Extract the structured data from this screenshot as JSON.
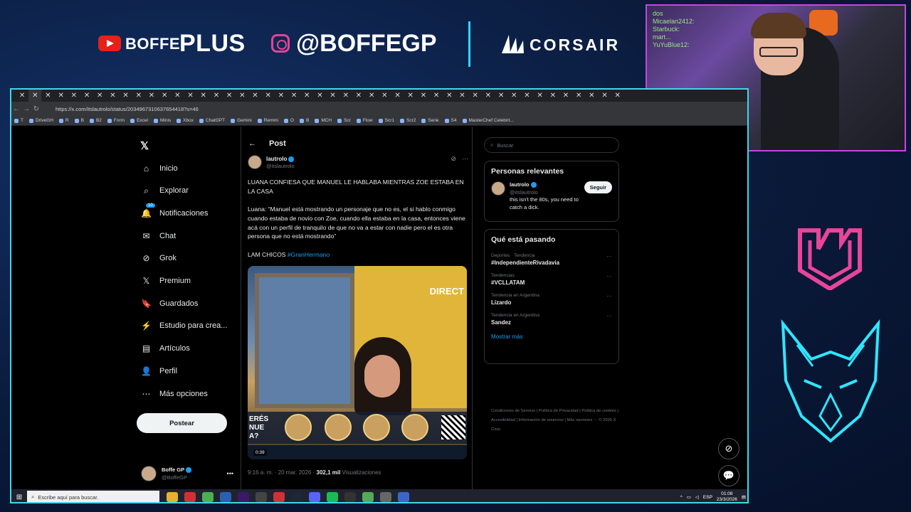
{
  "banner": {
    "youtube_name": "BOFFE",
    "youtube_plus": "PLUS",
    "instagram_handle": "@BOFFEGP",
    "sponsor": "CORSAIR"
  },
  "webcam": {
    "chat_lines": [
      "dos",
      "Micaelan2412:",
      "Starbuck:",
      "mart...",
      "YuYuBlue12:"
    ]
  },
  "browser": {
    "url": "https://x.com/itslautrolo/status/2034967310637654418?s=46",
    "bookmarks": [
      "T",
      "DriveGH",
      "R",
      "B",
      "B2",
      "Form",
      "Excel",
      "Minis",
      "Xbox",
      "ChatGPT",
      "Gemini",
      "Remini",
      "O",
      "B",
      "MCH",
      "Scr",
      "Flow",
      "Scr1",
      "Scr2",
      "Serie",
      "S4",
      "MasterChef Celebrit..."
    ]
  },
  "x": {
    "nav": [
      {
        "label": "Inicio",
        "icon": "home-icon"
      },
      {
        "label": "Explorar",
        "icon": "search-icon"
      },
      {
        "label": "Notificaciones",
        "icon": "bell-icon",
        "badge": "10"
      },
      {
        "label": "Chat",
        "icon": "chat-icon"
      },
      {
        "label": "Grok",
        "icon": "grok-icon"
      },
      {
        "label": "Premium",
        "icon": "premium-icon"
      },
      {
        "label": "Guardados",
        "icon": "bookmark-icon"
      },
      {
        "label": "Estudio para crea...",
        "icon": "studio-icon"
      },
      {
        "label": "Artículos",
        "icon": "articles-icon"
      },
      {
        "label": "Perfil",
        "icon": "profile-icon"
      },
      {
        "label": "Más opciones",
        "icon": "more-icon"
      }
    ],
    "post_button": "Postear",
    "profile": {
      "name": "Boffe GP",
      "handle": "@BoffeGP"
    },
    "post": {
      "header": "Post",
      "author_name": "lautrolo",
      "author_handle": "@itslautrolo",
      "text1": "LUANA CONFIESA QUE MANUEL LE HABLABA MIENTRAS ZOE ESTABA EN LA CASA",
      "text2": "Luana: “Manuel está mostrando un personaje que no es, el si hablo conmigo cuando estaba de novio con Zoe, cuando ella estaba en la casa, entonces viene acá con un perfil de tranquilo de que no va a estar con nadie pero el es otra persona que no está mostrando”",
      "text3_prefix": "LAM CHICOS ",
      "hashtag": "#GranHermano",
      "media_directo": "DIRECT",
      "media_vote": "ERÉS\nNUE\nA?",
      "media_time": "0:39",
      "timestamp": "9:16 a. m. · 20 mar. 2026 · ",
      "views_count": "302,1 mil",
      "views_label": " Visualizaciones"
    },
    "search_placeholder": "Buscar",
    "relevant": {
      "title": "Personas relevantes",
      "name": "lautrolo",
      "handle": "@itslautrolo",
      "bio": "this isn't the 80s, you need to catch a dick.",
      "follow": "Seguir"
    },
    "trends": {
      "title": "Qué está pasando",
      "items": [
        {
          "context": "Deportes · Tendencia",
          "topic": "#IndependienteRivadavia"
        },
        {
          "context": "Tendencias",
          "topic": "#VCLLATAM"
        },
        {
          "context": "Tendencia en Argentina",
          "topic": "Lizardo"
        },
        {
          "context": "Tendencia en Argentina",
          "topic": "Sandez"
        }
      ],
      "show_more": "Mostrar más"
    },
    "footer": "Condiciones de Servicio | Política de Privacidad | Política de cookies | Accesibilidad | Información de anuncios | Más opciones ··· © 2026 X Corp."
  },
  "taskbar": {
    "search_placeholder": "Escribe aquí para buscar.",
    "lang": "ESP",
    "time": "01:08",
    "date": "23/3/2026"
  }
}
